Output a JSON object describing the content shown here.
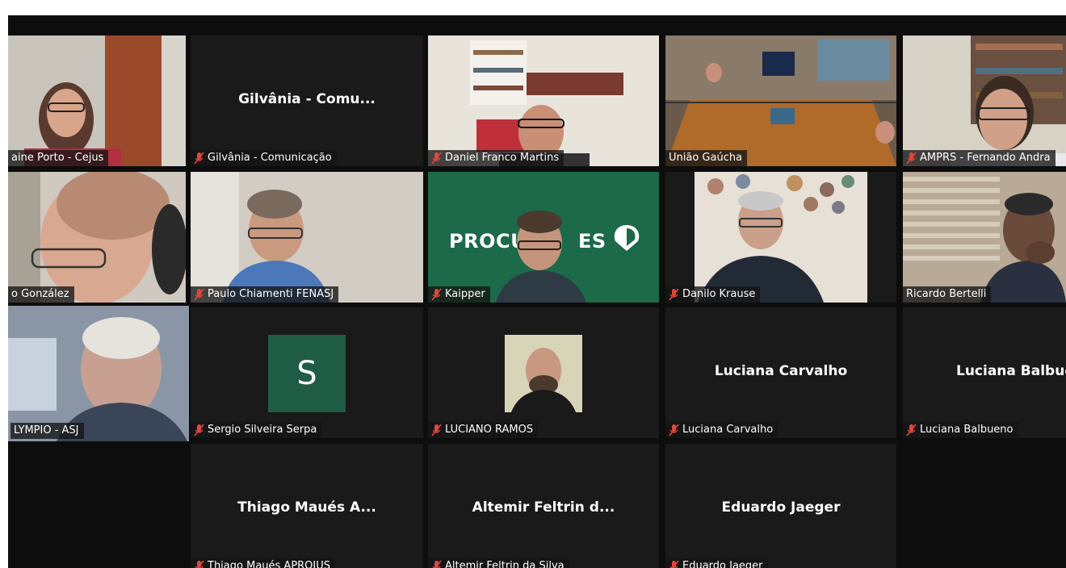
{
  "participants": [
    {
      "label": "aine Porto - Cejus",
      "muted": false
    },
    {
      "label": "Gilvânia - Comunicação",
      "display_name": "Gilvânia - Comu...",
      "muted": true
    },
    {
      "label": "Daniel Franco Martins",
      "muted": true
    },
    {
      "label": "União Gaúcha",
      "muted": false
    },
    {
      "label": "AMPRS - Fernando Andra",
      "muted": true
    },
    {
      "label": "o González",
      "muted": false
    },
    {
      "label": "Paulo Chiamenti FENASJ",
      "muted": true
    },
    {
      "label": "Kaipper",
      "muted": true,
      "banner_text": "PROCURA",
      "banner_text2": "ES"
    },
    {
      "label": "Danilo Krause",
      "muted": true
    },
    {
      "label": "Ricardo Bertelli",
      "muted": false
    },
    {
      "label": "LYMPIO - ASJ",
      "muted": false
    },
    {
      "label": "Sergio Silveira Serpa",
      "muted": true,
      "avatar_letter": "S"
    },
    {
      "label": "LUCIANO RAMOS",
      "muted": true
    },
    {
      "label": "Luciana Carvalho",
      "display_name": "Luciana Carvalho",
      "muted": true
    },
    {
      "label": "Luciana Balbueno",
      "display_name": "Luciana Balbuer",
      "muted": true
    },
    {
      "label": "Thiago Maués APROJUS",
      "display_name": "Thiago Maués A...",
      "muted": true
    },
    {
      "label": "Altemir Feltrin da Silva",
      "display_name": "Altemir Feltrin d...",
      "muted": true
    },
    {
      "label": "Eduardo Jaeger",
      "display_name": "Eduardo Jaeger",
      "muted": true
    }
  ],
  "colors": {
    "muted_icon": "#e0483e",
    "active_speaker_border": "#c8e67a",
    "avatar_bg": "#1f5c45"
  }
}
